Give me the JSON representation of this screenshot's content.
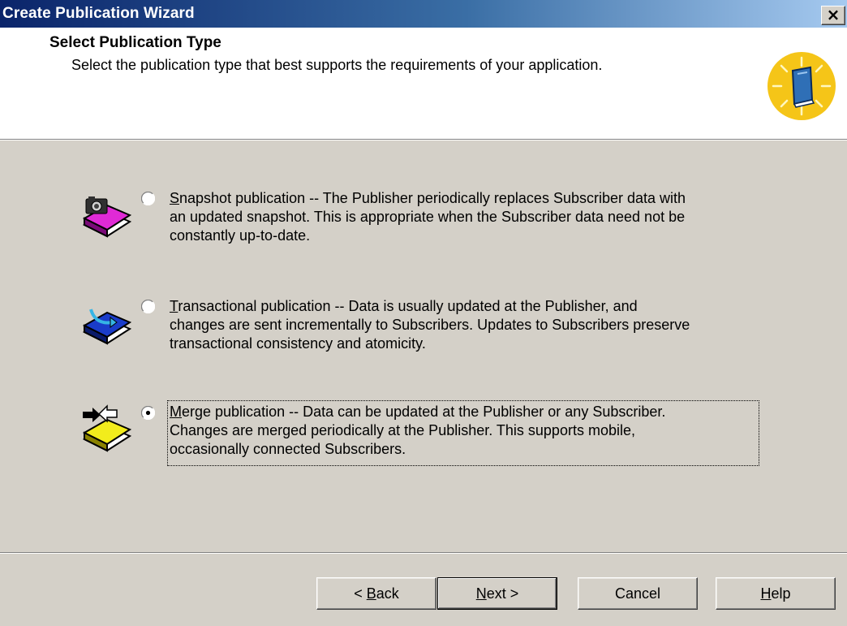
{
  "window": {
    "title": "Create Publication Wizard",
    "close_glyph": "×"
  },
  "header": {
    "title": "Select Publication Type",
    "subtitle": "Select the publication type that best supports the requirements of your application.",
    "icon": "wizard-book-icon"
  },
  "options": [
    {
      "id": "snapshot",
      "icon": "snapshot-book-icon",
      "selected": false,
      "mnemonic": "S",
      "text": "napshot publication -- The Publisher periodically replaces Subscriber data with\nan updated snapshot. This is appropriate when the Subscriber data need not be\nconstantly up-to-date."
    },
    {
      "id": "transactional",
      "icon": "transactional-book-icon",
      "selected": false,
      "mnemonic": "T",
      "text": "ransactional publication -- Data is usually updated at the Publisher, and\nchanges are sent incrementally to Subscribers. Updates to Subscribers preserve\ntransactional consistency and atomicity."
    },
    {
      "id": "merge",
      "icon": "merge-book-icon",
      "selected": true,
      "mnemonic": "M",
      "text": "erge publication -- Data can be updated at the Publisher or any Subscriber.\nChanges are merged periodically at the Publisher. This supports mobile,\noccasionally connected Subscribers."
    }
  ],
  "buttons": {
    "back": {
      "prefix": "< ",
      "mnemonic": "B",
      "rest": "ack"
    },
    "next": {
      "mnemonic": "N",
      "rest": "ext >"
    },
    "cancel": {
      "label": "Cancel"
    },
    "help": {
      "mnemonic": "H",
      "rest": "elp"
    }
  },
  "colors": {
    "titlebar_start": "#0a246a",
    "titlebar_end": "#a6caf0",
    "dialog_face": "#d4d0c8",
    "header_bg": "#ffffff"
  }
}
